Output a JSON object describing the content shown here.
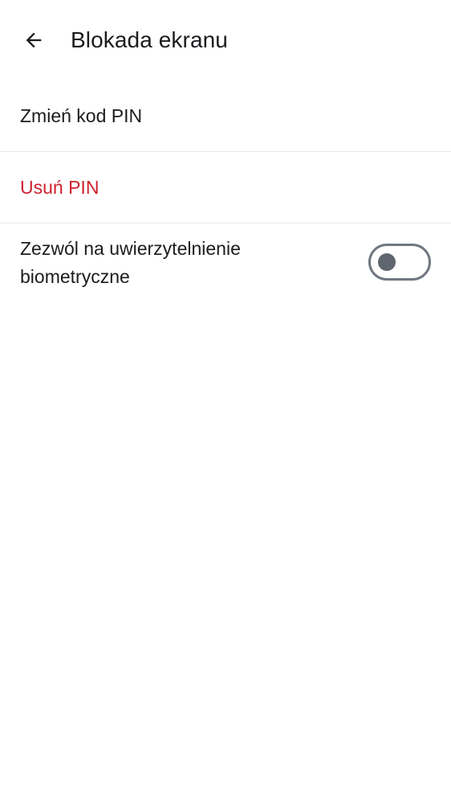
{
  "header": {
    "back_icon": "arrow-left-icon",
    "title": "Blokada ekranu"
  },
  "settings": {
    "change_pin": "Zmień kod PIN",
    "remove_pin": "Usuń PIN",
    "biometric_label": "Zezwól na uwierzytelnienie biometryczne",
    "biometric_enabled": false
  },
  "colors": {
    "destructive": "#d0202e",
    "toggle_outline": "#707780",
    "toggle_thumb": "#5f666f"
  }
}
